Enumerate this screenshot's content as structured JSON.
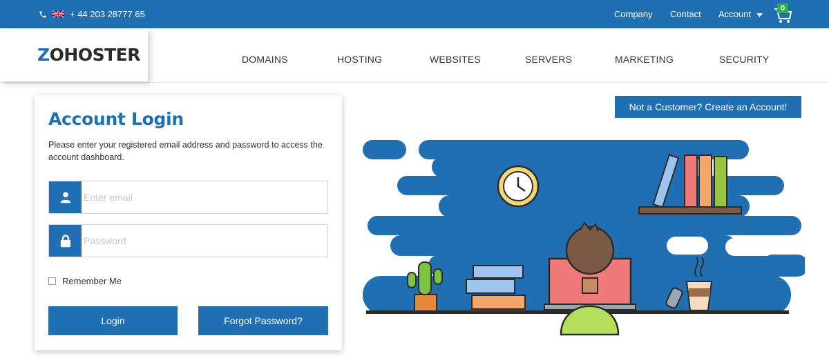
{
  "topbar": {
    "phone": "+ 44 203 28777 65",
    "links": [
      "Company",
      "Contact",
      "Account"
    ],
    "cart_count": "0",
    "colors": {
      "bar": "#1f6fb2",
      "badge": "#2bb24c"
    }
  },
  "header": {
    "logo_first": "Z",
    "logo_rest": "OHOSTER",
    "nav": [
      "DOMAINS",
      "HOSTING",
      "WEBSITES",
      "SERVERS",
      "MARKETING",
      "SECURITY"
    ]
  },
  "login": {
    "title": "Account Login",
    "description": "Please enter your registered email address and password to access the account dashboard.",
    "email_placeholder": "Enter email",
    "email_value": "",
    "password_placeholder": "Password",
    "password_value": "",
    "remember_label": "Remember Me",
    "login_label": "Login",
    "forgot_label": "Forgot Password?"
  },
  "cta": {
    "label": "Not a Customer? Create an Account!"
  },
  "icons": [
    "phone-icon",
    "uk-flag-icon",
    "caret-down-icon",
    "cart-icon",
    "user-icon",
    "lock-icon"
  ]
}
